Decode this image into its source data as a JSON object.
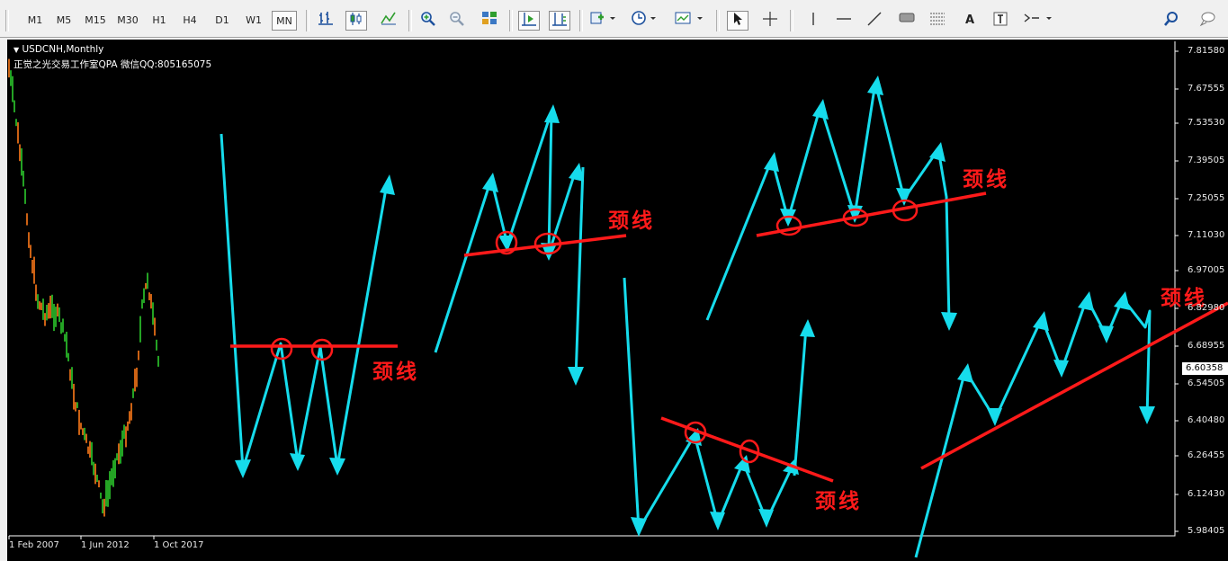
{
  "toolbar": {
    "timeframes": [
      "M1",
      "M5",
      "M15",
      "M30",
      "H1",
      "H4",
      "D1",
      "W1",
      "MN"
    ],
    "active_timeframe": "MN",
    "tool_icons": {
      "bar_chart": "bar-chart-icon",
      "candlestick": "candlestick-icon",
      "line_chart": "line-chart-icon",
      "zoom_in": "zoom-in-icon",
      "zoom_out": "zoom-out-icon",
      "tile_windows": "tile-windows-icon",
      "chart_shift": "chart-shift-icon",
      "autoscroll": "autoscroll-icon",
      "indicators": "indicators-icon",
      "periods": "clock-icon",
      "templates": "template-icon",
      "cursor": "cursor-arrow-icon",
      "crosshair": "crosshair-icon",
      "vertical_line": "vertical-line-icon",
      "horizontal_line": "horizontal-line-icon",
      "trendline": "trendline-icon",
      "rectangle": "rectangle-icon",
      "fibonacci": "fibonacci-icon",
      "text_label": "text-label-icon",
      "text_box": "text-box-icon",
      "arrows": "arrows-icon",
      "search": "search-icon",
      "chat": "chat-icon"
    },
    "text_tool_glyph": "A",
    "colors": {
      "active_icon": "#1b4f9c",
      "accent": "#2f9e2f"
    }
  },
  "chart": {
    "symbol_line": "USDCNH,Monthly",
    "note_line": "正觉之光交易工作室QPA 微信QQ:805165075",
    "neckline_label": "颈线",
    "price_labels": [
      "7.81580",
      "7.67555",
      "7.53530",
      "7.39505",
      "7.25055",
      "7.11030",
      "6.97005",
      "6.82980",
      "6.68955",
      "6.54505",
      "6.40480",
      "6.26455",
      "6.12430",
      "5.98405"
    ],
    "current_price": "6.60358",
    "date_labels": [
      "1 Feb 2007",
      "1 Jun 2012",
      "1 Oct 2017"
    ],
    "colors": {
      "background": "#000000",
      "pattern_arrows": "#16dcec",
      "neckline": "#ff1a1a",
      "bull_bars": "#2ecc2e",
      "bear_bars": "#ff7a1a"
    }
  }
}
